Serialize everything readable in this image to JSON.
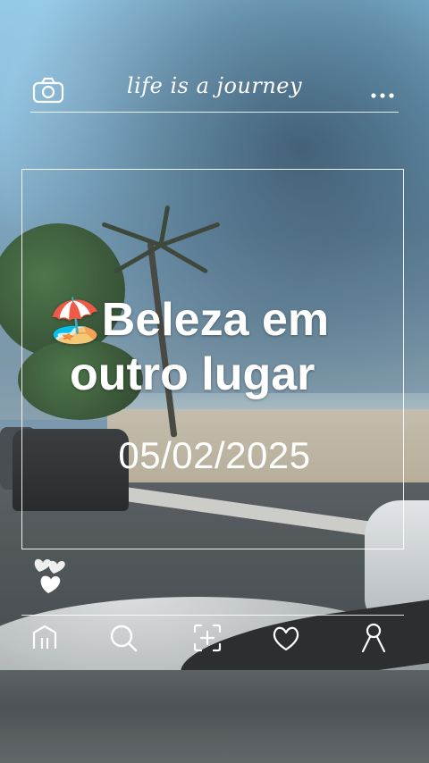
{
  "header": {
    "slogan": "life is a journey",
    "left_icon": "camera-icon",
    "right_icon": "more-dots-icon"
  },
  "overlay": {
    "emoji": "🏖️",
    "headline_line1": "Beleza em",
    "headline_line2": "outro lugar",
    "date": "05/02/2025",
    "hearts_icon": "hearts-icon"
  },
  "nav": {
    "items": [
      {
        "icon": "home-icon"
      },
      {
        "icon": "search-icon"
      },
      {
        "icon": "add-icon"
      },
      {
        "icon": "heart-icon"
      },
      {
        "icon": "profile-icon"
      }
    ]
  },
  "colors": {
    "ui_white": "#ffffff"
  }
}
